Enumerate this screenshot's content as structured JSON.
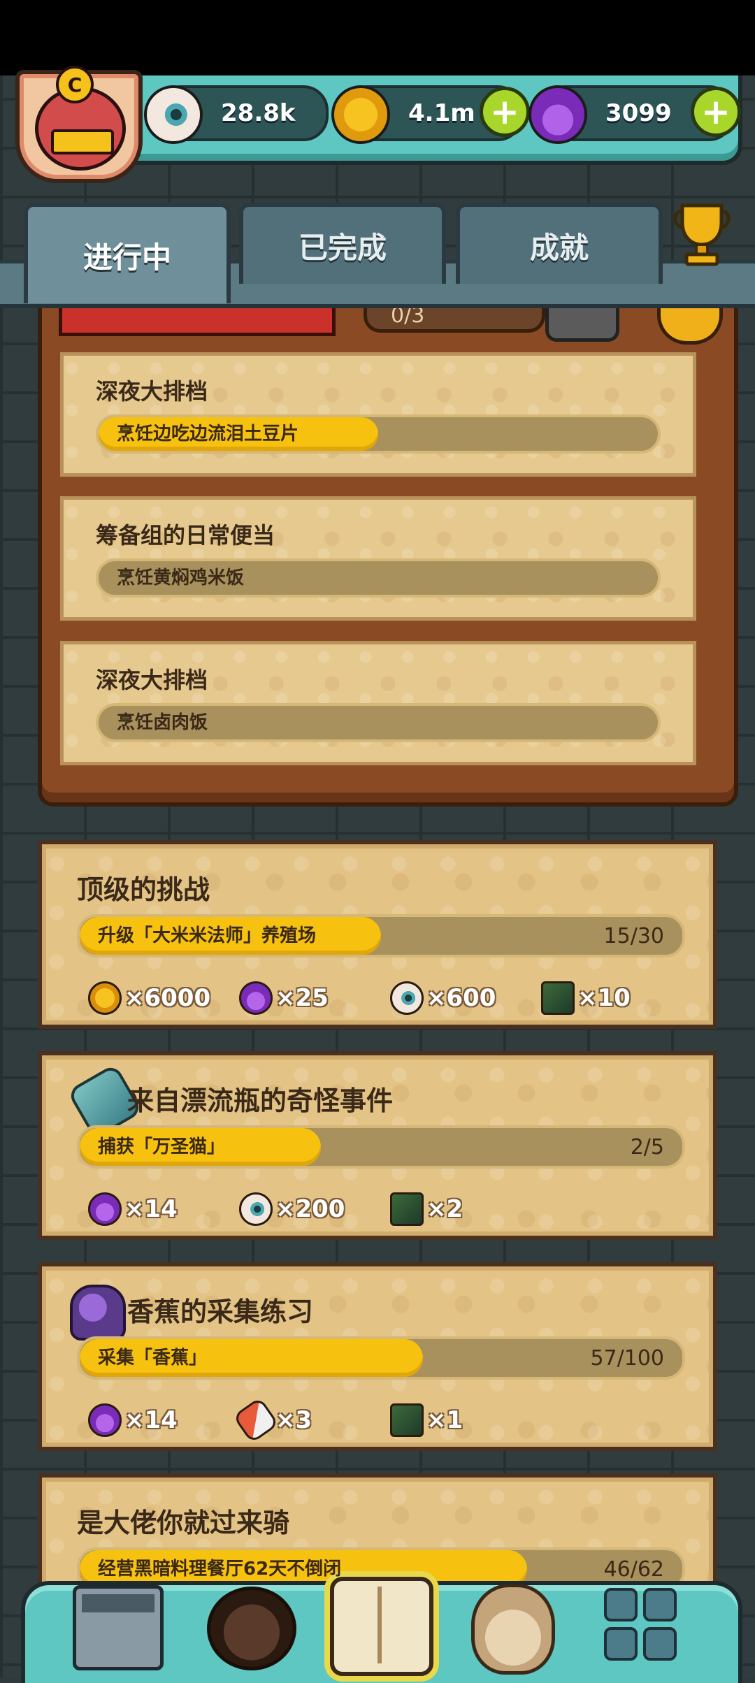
{
  "header": {
    "avatar_badge": "C",
    "resources": [
      {
        "name": "eyeball",
        "icon": "eyeball-icon",
        "value": "28.8k",
        "has_plus": false
      },
      {
        "name": "coin",
        "icon": "coin-icon",
        "value": "4.1m",
        "has_plus": true
      },
      {
        "name": "potion",
        "icon": "potion-icon",
        "value": "3099",
        "has_plus": true
      }
    ],
    "plus_symbol": "+"
  },
  "tabs": [
    {
      "label": "进行中",
      "active": true
    },
    {
      "label": "已完成",
      "active": false
    },
    {
      "label": "成就",
      "active": false
    }
  ],
  "daily_board": {
    "count": "0/3",
    "tasks": [
      {
        "title": "深夜大排档",
        "progress_label": "烹饪边吃边流泪土豆片",
        "progress": 0.5
      },
      {
        "title": "筹备组的日常便当",
        "progress_label": "烹饪黄焖鸡米饭",
        "progress": 0
      },
      {
        "title": "深夜大排档",
        "progress_label": "烹饪卤肉饭",
        "progress": 0
      }
    ]
  },
  "achievements": [
    {
      "title": "顶级的挑战",
      "icon": null,
      "progress_label": "升级「大米米法师」养殖场",
      "count": "15/30",
      "progress": 0.5,
      "rewards": [
        {
          "icon": "coin",
          "text": "×6000"
        },
        {
          "icon": "potion",
          "text": "×25"
        },
        {
          "icon": "eye",
          "text": "×600"
        },
        {
          "icon": "card-item",
          "text": "×10"
        }
      ]
    },
    {
      "title": "来自漂流瓶的奇怪事件",
      "icon": "bottle-icon",
      "progress_label": "捕获「万圣猫」",
      "count": "2/5",
      "progress": 0.4,
      "rewards": [
        {
          "icon": "potion",
          "text": "×14"
        },
        {
          "icon": "eye",
          "text": "×200"
        },
        {
          "icon": "card-item",
          "text": "×2"
        }
      ]
    },
    {
      "title": "香蕉的采集练习",
      "icon": "monster-icon",
      "progress_label": "采集「香蕉」",
      "count": "57/100",
      "progress": 0.57,
      "rewards": [
        {
          "icon": "potion",
          "text": "×14"
        },
        {
          "icon": "pill",
          "text": "×3"
        },
        {
          "icon": "card-item",
          "text": "×1"
        }
      ]
    },
    {
      "title": "是大佬你就过来骑",
      "icon": null,
      "progress_label": "经营黑暗料理餐厅62天不倒闭",
      "count": "46/62",
      "progress": 0.742,
      "rewards": []
    }
  ],
  "bottom_nav": [
    {
      "name": "shop",
      "icon": "shop-icon"
    },
    {
      "name": "monster",
      "icon": "monster-icon"
    },
    {
      "name": "quest-book",
      "icon": "book-icon",
      "active": true
    },
    {
      "name": "bag",
      "icon": "bag-icon"
    },
    {
      "name": "menu",
      "icon": "grid-icon"
    }
  ]
}
